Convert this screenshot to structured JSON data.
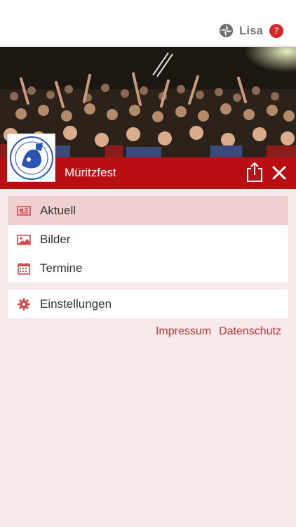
{
  "header": {
    "user_name": "Lisa",
    "notification_count": "7"
  },
  "app": {
    "title": "Müritzfest",
    "accent_color": "#b90e12"
  },
  "menu": {
    "primary": [
      {
        "label": "Aktuell",
        "icon": "newspaper-icon",
        "active": true
      },
      {
        "label": "Bilder",
        "icon": "image-icon",
        "active": false
      },
      {
        "label": "Termine",
        "icon": "calendar-icon",
        "active": false
      }
    ],
    "secondary": [
      {
        "label": "Einstellungen",
        "icon": "gear-icon",
        "active": false
      }
    ]
  },
  "footer": {
    "impressum": "Impressum",
    "datenschutz": "Datenschutz"
  }
}
